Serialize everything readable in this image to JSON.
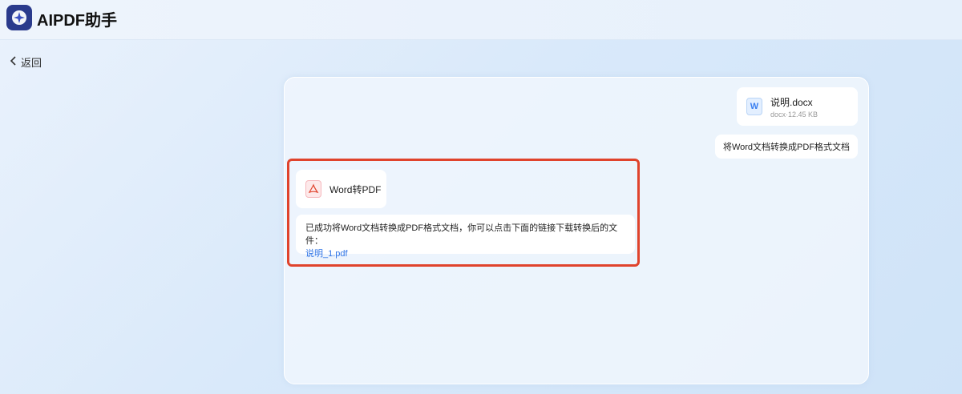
{
  "app": {
    "title": "AIPDF助手",
    "logo_icon": "sparkle-logo-icon"
  },
  "nav": {
    "back_label": "返回"
  },
  "conversation": {
    "attachment": {
      "file_name": "说明.docx",
      "file_meta": "docx·12.45 KB",
      "icon": "word-file-icon"
    },
    "user_message": "将Word文档转换成PDF格式文档",
    "tool": {
      "label": "Word转PDF",
      "icon": "pdf-file-icon"
    },
    "reply": {
      "text": "已成功将Word文档转换成PDF格式文档，你可以点击下面的链接下载转换后的文件：",
      "link_text": "说明_1.pdf"
    }
  },
  "colors": {
    "accent": "#2f74e6",
    "highlight_border": "#e0432c",
    "logo_bg": "#2a3a8c"
  }
}
